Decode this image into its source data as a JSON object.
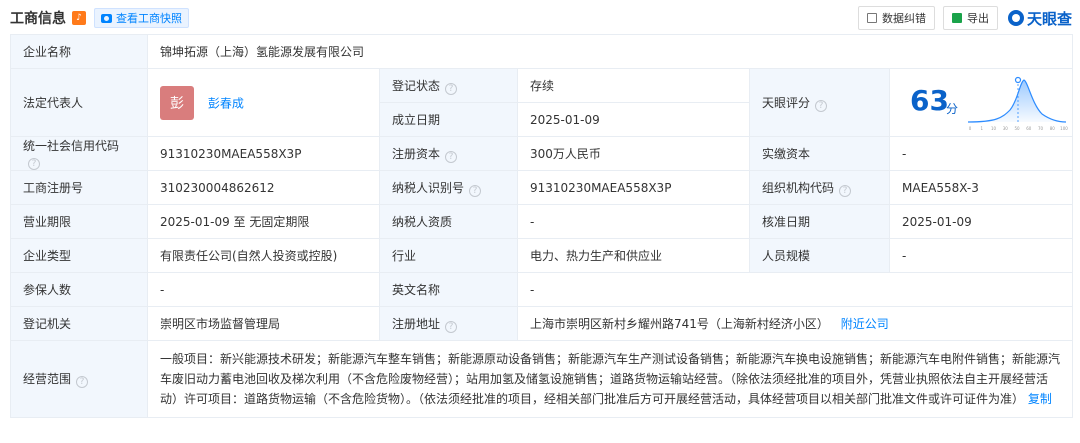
{
  "header": {
    "title": "工商信息",
    "snapshot_label": "查看工商快照",
    "feedback_label": "数据纠错",
    "export_label": "导出",
    "logo_text": "天眼查"
  },
  "colors": {
    "accent": "#0084ff",
    "label_bg": "#f2f7fd",
    "status_green": "#1aa34a",
    "score_blue": "#0a62c9"
  },
  "company": {
    "name_label": "企业名称",
    "name": "锦坤拓源（上海）氢能源发展有限公司",
    "legal_rep_label": "法定代表人",
    "legal_rep_avatar": "彭",
    "legal_rep_name": "彭春成",
    "status_label": "登记状态",
    "status": "存续",
    "found_label": "成立日期",
    "found_date": "2025-01-09",
    "score_label": "天眼评分",
    "score": "63",
    "score_unit": "分",
    "credit_code_label": "统一社会信用代码",
    "credit_code": "91310230MAEA558X3P",
    "reg_capital_label": "注册资本",
    "reg_capital": "300万人民币",
    "paid_capital_label": "实缴资本",
    "paid_capital": "-",
    "reg_no_label": "工商注册号",
    "reg_no": "310230004862612",
    "taxpayer_id_label": "纳税人识别号",
    "taxpayer_id": "91310230MAEA558X3P",
    "org_code_label": "组织机构代码",
    "org_code": "MAEA558X-3",
    "term_label": "营业期限",
    "term": "2025-01-09 至 无固定期限",
    "taxpayer_qual_label": "纳税人资质",
    "taxpayer_qual": "-",
    "approve_label": "核准日期",
    "approve_date": "2025-01-09",
    "type_label": "企业类型",
    "type": "有限责任公司(自然人投资或控股)",
    "industry_label": "行业",
    "industry": "电力、热力生产和供应业",
    "staff_label": "人员规模",
    "staff": "-",
    "insured_label": "参保人数",
    "insured": "-",
    "en_name_label": "英文名称",
    "en_name": "-",
    "authority_label": "登记机关",
    "authority": "崇明区市场监督管理局",
    "address_label": "注册地址",
    "address": "上海市崇明区新村乡耀州路741号（上海新村经济小区）",
    "nearby_label": "附近公司",
    "scope_label": "经营范围",
    "scope": "一般项目：新兴能源技术研发；新能源汽车整车销售；新能源原动设备销售；新能源汽车生产测试设备销售；新能源汽车换电设施销售；新能源汽车电附件销售；新能源汽车废旧动力蓄电池回收及梯次利用（不含危险废物经营）；站用加氢及储氢设施销售；道路货物运输站经营。（除依法须经批准的项目外，凭营业执照依法自主开展经营活动）许可项目：道路货物运输（不含危险货物）。（依法须经批准的项目，经相关部门批准后方可开展经营活动，具体经营项目以相关部门批准文件或许可证件为准）",
    "copy_label": "复制"
  },
  "score_axis": [
    "0",
    "1",
    "10",
    "30",
    "50",
    "60",
    "70",
    "80",
    "100"
  ]
}
